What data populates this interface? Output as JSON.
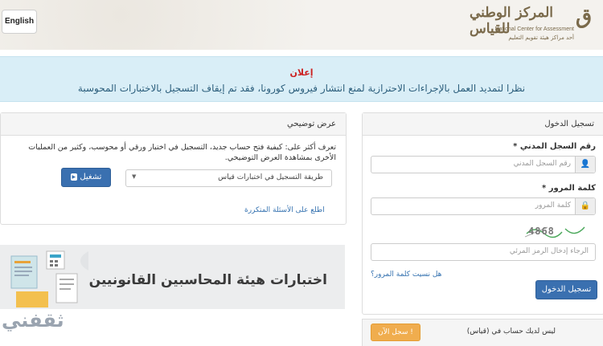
{
  "header": {
    "lang_button": "English",
    "logo_ar": "المركز الوطني للقياس",
    "logo_en": "National Center for Assessment",
    "logo_sub": "أحد مراكز هيئة تقويم التعليم"
  },
  "alert": {
    "title": "إعلان",
    "message": "نظرا لتمديد العمل بالإجراءات الاحترازية لمنع انتشار فيروس كورونا، فقد تم إيقاف التسجيل بالاختبارات المحوسبة"
  },
  "login": {
    "heading": "تسجيل الدخول",
    "id_label": "رقم السجل المدني *",
    "id_placeholder": "رقم السجل المدني",
    "password_label": "كلمة المرور *",
    "password_placeholder": "كلمة المرور",
    "captcha_text": "4868",
    "captcha_placeholder": "الرجاء إدخال الرمز المرئي",
    "forgot_link": "هل نسيت كلمة المرور؟",
    "submit_button": "تسجيل الدخول",
    "no_account_text": "ليس لديك حساب في (قياس)",
    "register_button": "سجل الآن !"
  },
  "demo": {
    "heading": "عرض توضيحي",
    "description": "تعرف أكثر على: كيفية فتح حساب جديد، التسجيل في اختبار ورقي أو محوسب، وكثير من العمليات الأخرى بمشاهدة العرض التوضيحي.",
    "select_value": "طريقة التسجيل في اختبارات قياس",
    "play_button": "تشغيل",
    "faq_link": "اطلع على الأسئلة المتكررة"
  },
  "banner": {
    "text": "اختبارات هيئة المحاسبين القانونيين"
  },
  "watermark": "ثقفني",
  "colors": {
    "alert_bg": "#d9eef7",
    "alert_title": "#cc2222",
    "primary_button": "#3a70b0",
    "register_button": "#f0ad4e"
  }
}
